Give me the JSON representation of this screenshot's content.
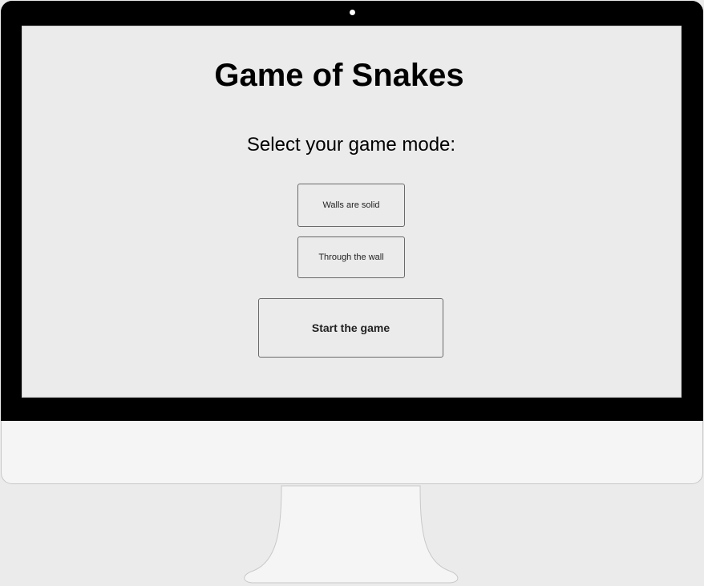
{
  "app": {
    "title": "Game of Snakes",
    "prompt": "Select your game mode:"
  },
  "modes": [
    {
      "label": "Walls are solid"
    },
    {
      "label": "Through the wall"
    }
  ],
  "actions": {
    "start_label": "Start the game"
  },
  "colors": {
    "bezel": "#000000",
    "screen": "#ebebeb",
    "chin": "#f5f5f5",
    "button_border": "#6a6a6a"
  }
}
